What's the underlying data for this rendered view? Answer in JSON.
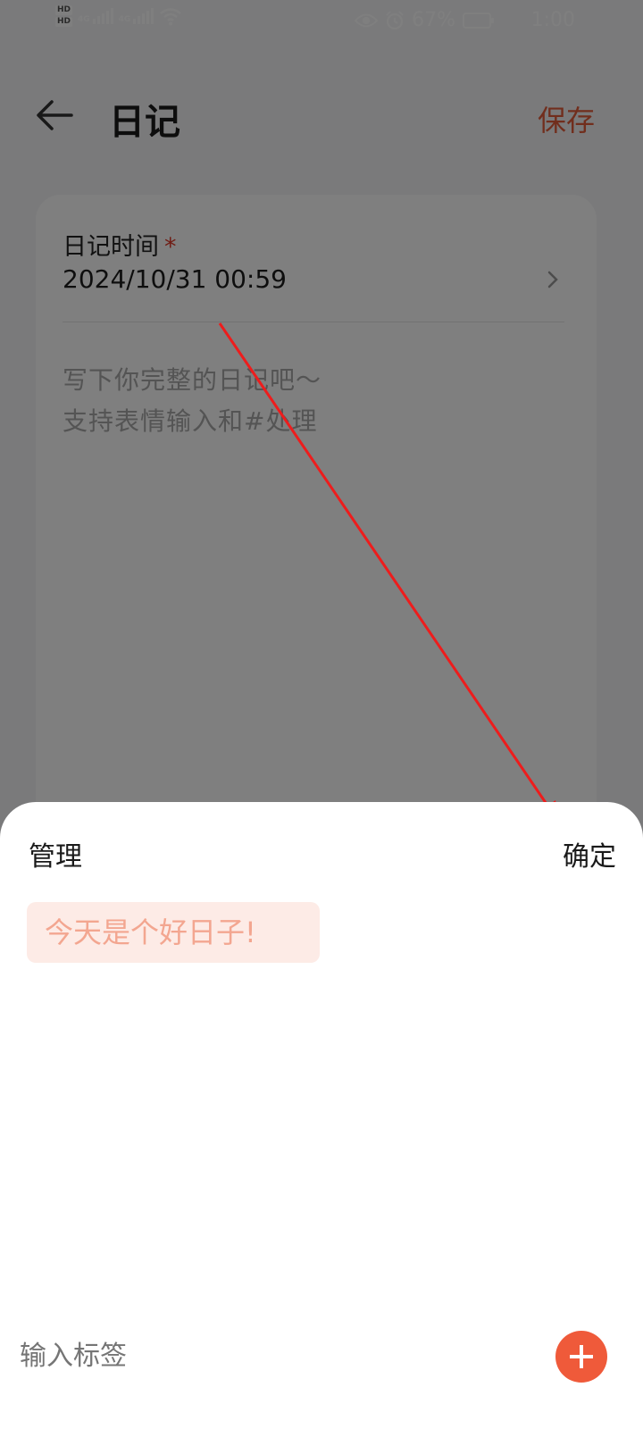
{
  "status_bar": {
    "hd1": "HD",
    "hd2": "HD",
    "network1": "4G",
    "network2": "4G",
    "battery": "67%",
    "time": "1:00"
  },
  "header": {
    "title": "日记",
    "save_label": "保存"
  },
  "form": {
    "time_label": "日记时间",
    "required_mark": "*",
    "time_value": "2024/10/31 00:59",
    "placeholder_line1": "写下你完整的日记吧～",
    "placeholder_line2": "支持表情输入和#处理"
  },
  "sheet": {
    "manage_label": "管理",
    "confirm_label": "确定",
    "tags": [
      "今天是个好日子!"
    ],
    "input_placeholder": "输入标签"
  },
  "colors": {
    "accent": "#e35d3a",
    "tag_bg": "#fdebe6",
    "tag_text": "#f3a690",
    "add_button": "#ef5a3a"
  }
}
